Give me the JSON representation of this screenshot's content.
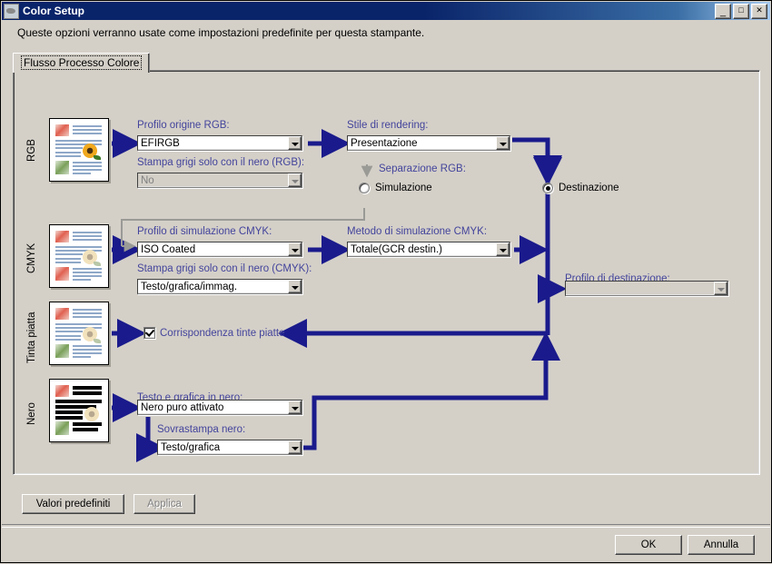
{
  "window": {
    "title": "Color Setup",
    "icon": "app-icon",
    "buttons": {
      "minimize": "_",
      "maximize": "□",
      "close": "✕"
    }
  },
  "hint": "Queste opzioni verranno usate come impostazioni predefinite per questa stampante.",
  "tab": {
    "label": "Flusso Processo Colore"
  },
  "colors": {
    "label_blue": "#44449c",
    "arrow_blue": "#1a1a8c",
    "arrow_gray": "#9a9a96",
    "titlebar_blue": "#0a246a",
    "face": "#d4d0c8"
  },
  "sections": {
    "rgb": {
      "vlabel": "RGB",
      "thumbnail": "document-thumbnail-rgb",
      "source_profile": {
        "label": "Profilo origine RGB:",
        "value": "EFIRGB"
      },
      "gray_black": {
        "label": "Stampa grigi solo con il nero (RGB):",
        "value": "No"
      },
      "rendering_style": {
        "label": "Stile di rendering:",
        "value": "Presentazione"
      },
      "separation": {
        "label": "Separazione RGB:",
        "option_simulation": "Simulazione",
        "option_destination": "Destinazione",
        "selected": "Destinazione"
      }
    },
    "cmyk": {
      "vlabel": "CMYK",
      "thumbnail": "document-thumbnail-cmyk",
      "simulation_profile": {
        "label": "Profilo di simulazione CMYK:",
        "value": "ISO Coated"
      },
      "gray_black": {
        "label": "Stampa grigi solo con il nero (CMYK):",
        "value": "Testo/grafica/immag."
      },
      "simulation_method": {
        "label": "Metodo di simulazione CMYK:",
        "value": "Totale(GCR destin.)"
      }
    },
    "spot": {
      "vlabel": "Tinta piatta",
      "thumbnail": "document-thumbnail-spot",
      "checkbox": {
        "label": "Corrispondenza tinte piatte",
        "checked": true
      }
    },
    "black": {
      "vlabel": "Nero",
      "thumbnail": "document-thumbnail-black",
      "text_graphics": {
        "label": "Testo e grafica in nero:",
        "value": "Nero puro attivato"
      },
      "overprint": {
        "label": "Sovrastampa nero:",
        "value": "Testo/grafica"
      }
    },
    "destination": {
      "profile": {
        "label": "Profilo di destinazione:",
        "value": ""
      }
    }
  },
  "buttons": {
    "defaults": {
      "label": "Valori predefiniti",
      "disabled": false
    },
    "apply": {
      "label": "Applica",
      "disabled": true
    },
    "ok": {
      "label": "OK",
      "disabled": false
    },
    "cancel": {
      "label": "Annulla",
      "disabled": false
    }
  }
}
